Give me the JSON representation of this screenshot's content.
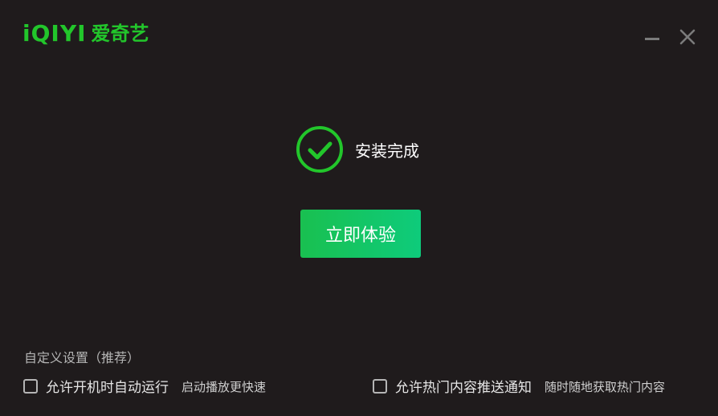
{
  "app": {
    "logo_latin": "iQIYI",
    "logo_cjk": "爱奇艺"
  },
  "window": {
    "minimize_icon": "minimize-icon",
    "close_icon": "close-icon"
  },
  "status": {
    "icon": "check-circle-icon",
    "text": "安装完成"
  },
  "actions": {
    "primary_button_label": "立即体验"
  },
  "settings": {
    "title": "自定义设置（推荐）",
    "options": [
      {
        "label": "允许开机时自动运行",
        "hint": "启动播放更快速",
        "checked": false
      },
      {
        "label": "允许热门内容推送通知",
        "hint": "随时随地获取热门内容",
        "checked": false
      }
    ]
  },
  "colors": {
    "brand_green": "#22c62b",
    "button_gradient_start": "#19c050",
    "button_gradient_end": "#0ecb7b",
    "background": "#1f1b1c"
  }
}
